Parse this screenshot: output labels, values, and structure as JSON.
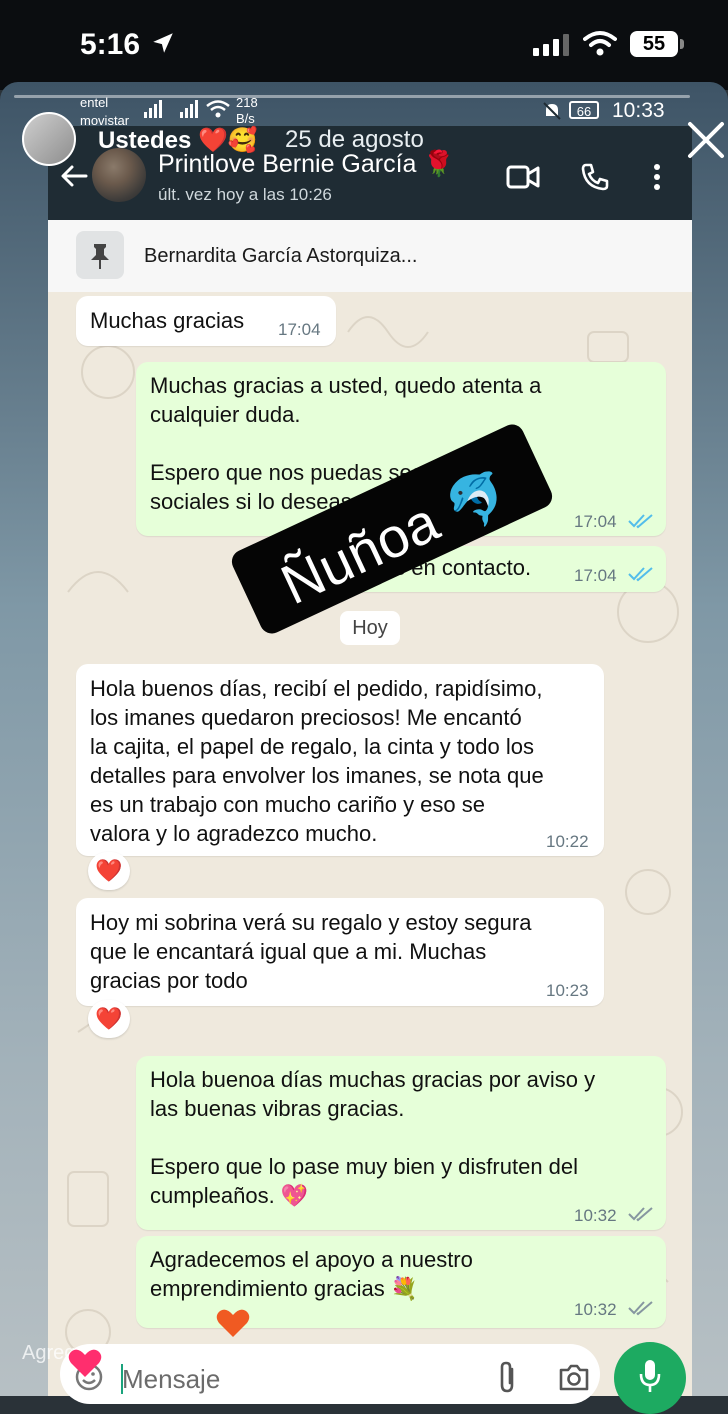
{
  "ios_status": {
    "time": "5:16",
    "battery": "55"
  },
  "android_status": {
    "carrier1": "entel",
    "carrier2": "movistar",
    "net_speed_value": "218",
    "net_speed_unit": "B/s",
    "battery": "66",
    "time": "10:33"
  },
  "story": {
    "username": "Ustedes",
    "username_emoji": "❤️🥰",
    "date": "25 de agosto",
    "sticker_text": "Ñuñoa",
    "sticker_emoji": "🐬",
    "comment_placeholder": "Agrega un comentario..."
  },
  "chat_header": {
    "contact_name": "Printlove Bernie García",
    "name_emoji": "🌹",
    "last_seen": "últ. vez hoy a las 10:26"
  },
  "pinned": {
    "text": "Bernardita García Astorquiza..."
  },
  "day_separator": "Hoy",
  "messages": [
    {
      "direction": "in",
      "text": "Muchas gracias",
      "time": "17:04"
    },
    {
      "direction": "out",
      "text": "Muchas gracias a usted, quedo atenta a\ncualquier duda.\n\nEspero que nos puedas seguir en redes\nsociales si lo deseas.",
      "time": "17:04"
    },
    {
      "direction": "out",
      "text": "Estaremos en contacto.",
      "time": "17:04"
    },
    {
      "direction": "in",
      "text": "Hola buenos días, recibí el pedido, rapidísimo,\nlos imanes quedaron preciosos! Me encantó\nla cajita, el papel de regalo, la cinta y todo los\ndetalles para envolver los imanes, se nota que\nes un trabajo con mucho cariño y eso se\nvalora y lo agradezco mucho.",
      "time": "10:22",
      "reaction": "❤️"
    },
    {
      "direction": "in",
      "text": "Hoy mi sobrina verá su regalo y estoy segura\nque le encantará igual que a mi. Muchas\ngracias por todo",
      "time": "10:23",
      "reaction": "❤️"
    },
    {
      "direction": "out",
      "text": "Hola buenoa días muchas gracias por aviso y\nlas buenas vibras gracias.\n\nEspero que lo pase muy bien y disfruten del\ncumpleaños. 💖",
      "time": "10:32"
    },
    {
      "direction": "out",
      "text": "Agradecemos el apoyo a nuestro\nemprendimiento gracias 💐",
      "time": "10:32"
    }
  ],
  "input": {
    "placeholder": "Mensaje"
  },
  "colors": {
    "header": "#1f2c34",
    "chat_bg": "#efe9dd",
    "outgoing": "#e6ffd9",
    "tick_blue": "#53bdeb",
    "mic_green": "#1daa61"
  },
  "icons": [
    "location-arrow-icon",
    "signal-icon",
    "wifi-icon",
    "battery-icon",
    "back-arrow-icon",
    "video-call-icon",
    "phone-icon",
    "more-vert-icon",
    "pin-icon",
    "close-icon",
    "emoji-icon",
    "attach-icon",
    "camera-icon",
    "mic-icon",
    "heart-icon"
  ]
}
